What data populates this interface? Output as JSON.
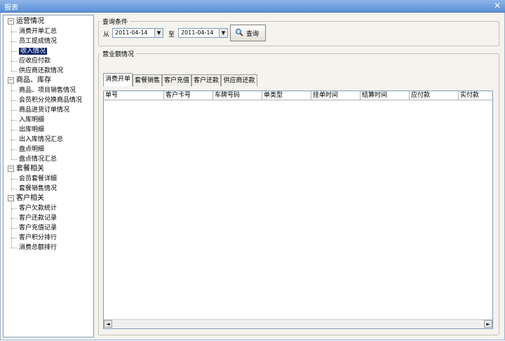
{
  "window": {
    "title": "报表",
    "close_glyph": "✕"
  },
  "tree": {
    "categories": [
      {
        "label": "运营情况",
        "items": [
          "消费开单汇总",
          "员工提成情况",
          "收入情况",
          "应收应付款",
          "供应商还款情况"
        ]
      },
      {
        "label": "商品、库存",
        "items": [
          "商品、项目销售情况",
          "会员积分兑换商品情况",
          "商品进货订单情况",
          "入库明细",
          "出库明细",
          "出入库情况汇总",
          "盘点明细",
          "盘点情况汇总"
        ]
      },
      {
        "label": "套餐相关",
        "items": [
          "会员套餐详细",
          "套餐销售情况"
        ]
      },
      {
        "label": "客户相关",
        "items": [
          "客户欠款统计",
          "客户还款记录",
          "客户充值记录",
          "客户积分排行",
          "消费总额排行"
        ]
      }
    ],
    "selected": "收入情况"
  },
  "query": {
    "group_title": "查询条件",
    "from_label": "从",
    "from_date": "2011-04-14",
    "to_label": "至",
    "to_date": "2011-04-14",
    "search_label": "查询"
  },
  "revenue": {
    "group_title": "营业额情况",
    "tabs": [
      "消费开单",
      "套餐销售",
      "客户充值",
      "客户还款",
      "供应商还款"
    ],
    "active_tab": "消费开单",
    "columns": [
      "单号",
      "客户卡号",
      "车牌号码",
      "单类型",
      "挂单时间",
      "结算时间",
      "应付款",
      "实付款"
    ]
  }
}
